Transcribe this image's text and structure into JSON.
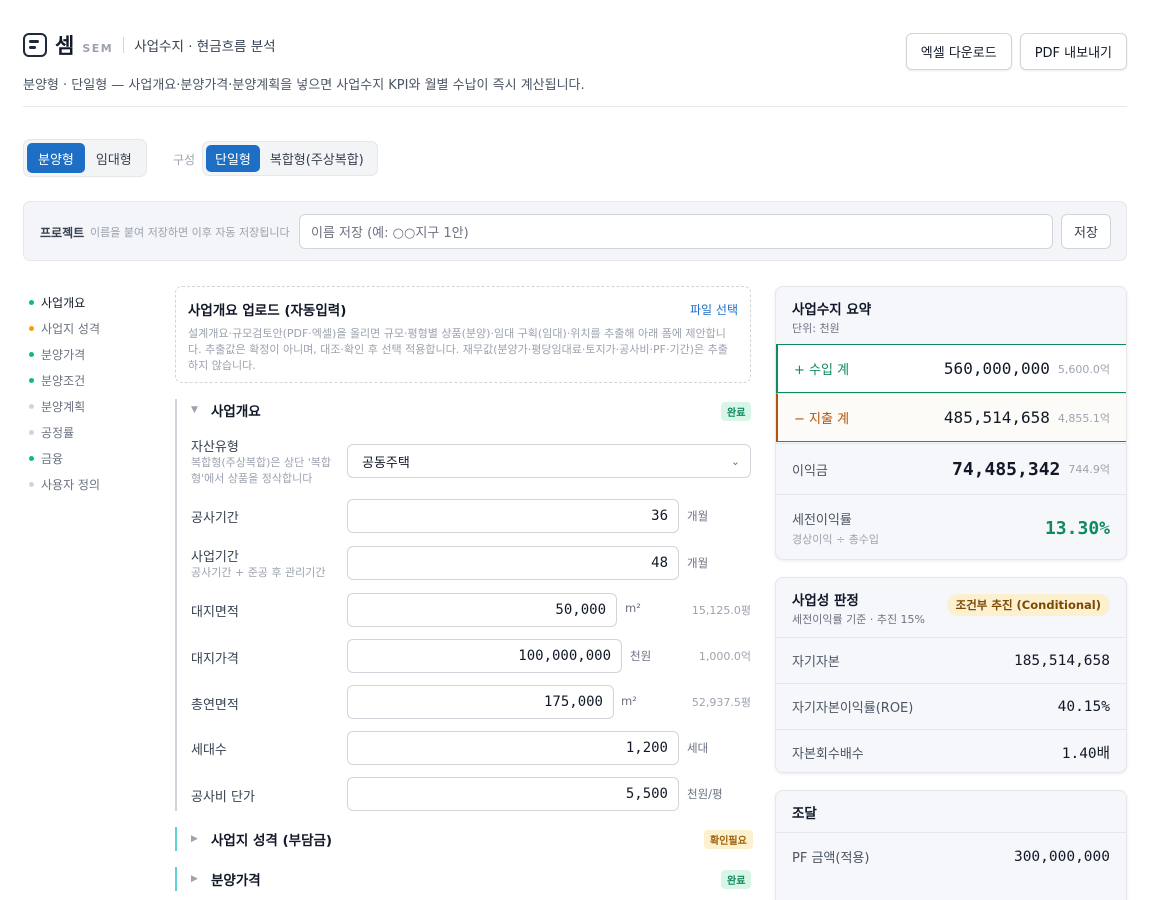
{
  "header": {
    "logo": "셈",
    "logo_sub": "SEM",
    "title": "사업수지 · 현금흐름 분석",
    "description": "분양형 · 단일형 — 사업개요·분양가격·분양계획을 넣으면 사업수지 KPI와 월별 수납이 즉시 계산됩니다.",
    "excel_button": "엑셀 다운로드",
    "pdf_button": "PDF 내보내기"
  },
  "modes": {
    "type_options": [
      "분양형",
      "임대형"
    ],
    "type_selected": "분양형",
    "composition_label": "구성",
    "composition_options": [
      "단일형",
      "복합형(주상복합)"
    ],
    "composition_selected": "단일형"
  },
  "project": {
    "label": "프로젝트",
    "hint": "이름을 붙여 저장하면 이후 자동 저장됩니다",
    "placeholder": "이름 저장 (예: ○○지구 1안)",
    "save_label": "저장"
  },
  "nav": [
    {
      "label": "사업개요",
      "status": "done",
      "color": "#10b981"
    },
    {
      "label": "사업지 성격",
      "status": "check",
      "color": "#f59e0b"
    },
    {
      "label": "분양가격",
      "status": "done",
      "color": "#10b981"
    },
    {
      "label": "분양조건",
      "status": "done",
      "color": "#10b981"
    },
    {
      "label": "분양계획",
      "status": "none",
      "color": "#d1d5db"
    },
    {
      "label": "공정률",
      "status": "none",
      "color": "#d1d5db"
    },
    {
      "label": "금융",
      "status": "done",
      "color": "#10b981"
    },
    {
      "label": "사용자 정의",
      "status": "none",
      "color": "#d1d5db"
    }
  ],
  "upload": {
    "title": "사업개요 업로드 (자동입력)",
    "link": "파일 선택",
    "desc_line1": "설계개요·규모검토안(PDF·엑셀)을 올리면 규모·평형별 상품(분양)·임대 구획(임대)·위치를 추출해 아래 폼에 제안합니",
    "desc_line2": "다. 추출값은 확정이 아니며, 대조·확인 후 선택 적용합니다. 재무값(분양가·평당임대료·토지가·공사비·PF·기간)은 추출",
    "desc_line3": "하지 않습니다."
  },
  "overview": {
    "title": "사업개요",
    "badge": "완료",
    "asset_type_label": "자산유형",
    "asset_type_sub1": "복합형(주상복합)은 상단 '복합",
    "asset_type_sub2": "형'에서 상품을 정삭합니다",
    "asset_type_value": "공동주택",
    "fields": [
      {
        "label": "공사기간",
        "value": "36",
        "unit": "개월"
      },
      {
        "label": "사업기간",
        "sub": "공사기간 + 준공 후 관리기간",
        "value": "48",
        "unit": "개월"
      },
      {
        "label": "대지면적",
        "value": "50,000",
        "unit": "m²",
        "conv": "15,125.0평"
      },
      {
        "label": "대지가격",
        "value": "100,000,000",
        "unit": "천원",
        "conv": "1,000.0억"
      },
      {
        "label": "총연면적",
        "value": "175,000",
        "unit": "m²",
        "conv": "52,937.5평"
      },
      {
        "label": "세대수",
        "value": "1,200",
        "unit": "세대"
      },
      {
        "label": "공사비 단가",
        "value": "5,500",
        "unit": "천원/평"
      }
    ]
  },
  "sections": [
    {
      "title": "사업지 성격 (부담금)",
      "badge": "확인필요"
    },
    {
      "title": "분양가격",
      "badge": "완료"
    }
  ],
  "summary": {
    "title": "사업수지 요약",
    "unit": "단위: 천원",
    "revenue_label": "+ 수입 계",
    "revenue_value": "560,000,000",
    "revenue_small": "5,600.0억",
    "expense_label": "− 지출 계",
    "expense_value": "485,514,658",
    "expense_small": "4,855.1억",
    "profit_label": "이익금",
    "profit_value": "74,485,342",
    "profit_small": "744.9억",
    "margin_label": "세전이익률",
    "margin_sub": "경상이익 ÷ 총수입",
    "margin_value": "13.30%"
  },
  "judgement": {
    "title": "사업성 판정",
    "sub": "세전이익률 기준 · 추진 15%",
    "badge": "조건부 추진 (Conditional)",
    "rows": [
      {
        "label": "자기자본",
        "value": "185,514,658"
      },
      {
        "label": "자기자본이익률(ROE)",
        "value": "40.15%"
      },
      {
        "label": "자본회수배수",
        "value": "1.40배"
      }
    ]
  },
  "funding": {
    "title": "조달",
    "rows": [
      {
        "label": "PF 금액(적용)",
        "value": "300,000,000"
      }
    ]
  },
  "colors": {
    "accent": "#1d6fc5",
    "revenue": "#0f8a5f",
    "expense": "#b45309",
    "margin": "#0f8a5f"
  }
}
